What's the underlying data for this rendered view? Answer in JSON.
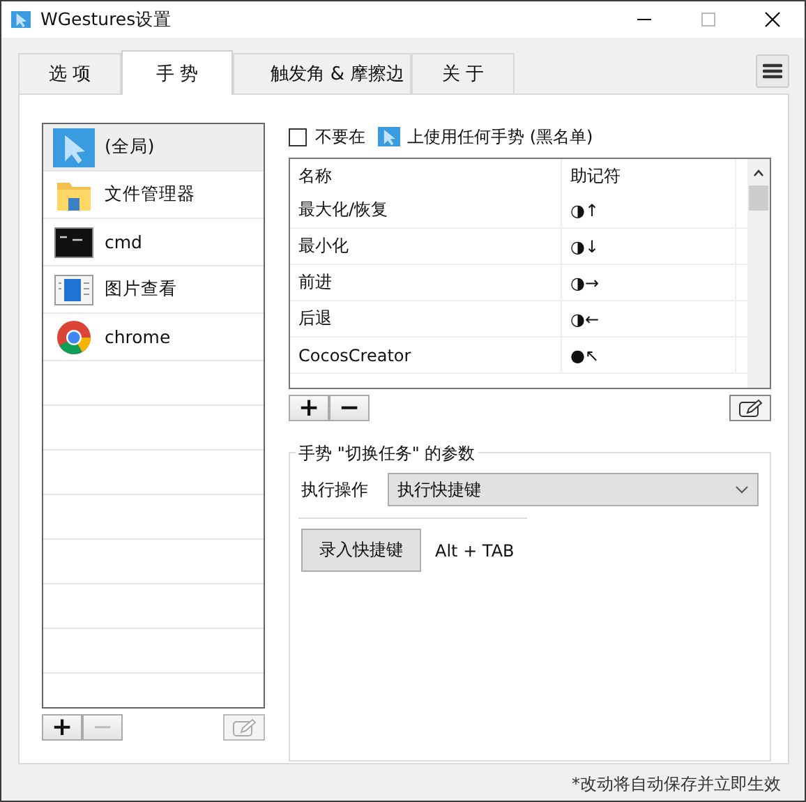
{
  "window": {
    "title": "WGestures设置"
  },
  "tabs": [
    {
      "label": "选 项",
      "selected": false
    },
    {
      "label": "手 势",
      "selected": true
    },
    {
      "label": "触发角 & 摩擦边",
      "selected": false
    },
    {
      "label": "关 于",
      "selected": false
    }
  ],
  "apps": {
    "items": [
      {
        "label": "(全局)",
        "kind": "global",
        "selected": true
      },
      {
        "label": "文件管理器",
        "kind": "folder",
        "selected": false
      },
      {
        "label": "cmd",
        "kind": "console",
        "selected": false
      },
      {
        "label": "图片查看",
        "kind": "viewer",
        "selected": false
      },
      {
        "label": "chrome",
        "kind": "browser",
        "selected": false
      }
    ],
    "buttons": [
      {
        "label": "+",
        "disabled": false
      },
      {
        "label": "−",
        "disabled": true
      }
    ],
    "edit_button": {
      "disabled": true
    }
  },
  "blacklist": {
    "checked": false,
    "before": "不要在",
    "after": "上使用任何手势 (黑名单)"
  },
  "gestures": {
    "columns": [
      "名称",
      "助记符"
    ],
    "rows": [
      {
        "name": "最大化/恢复",
        "mnemonic": "◑↑"
      },
      {
        "name": "最小化",
        "mnemonic": "◑↓"
      },
      {
        "name": "前进",
        "mnemonic": "◑→"
      },
      {
        "name": "后退",
        "mnemonic": "◑←"
      },
      {
        "name": "CocosCreator",
        "mnemonic": "●↖"
      }
    ],
    "buttons": [
      {
        "label": "+",
        "disabled": false
      },
      {
        "label": "−",
        "disabled": false
      }
    ],
    "edit_button": {
      "disabled": false
    }
  },
  "params": {
    "title": "手势 \"切换任务\" 的参数",
    "action_label": "执行操作",
    "action_value": "执行快捷键",
    "record_button": "录入快捷键",
    "hotkey": "Alt + TAB"
  },
  "footer": "*改动将自动保存并立即生效"
}
